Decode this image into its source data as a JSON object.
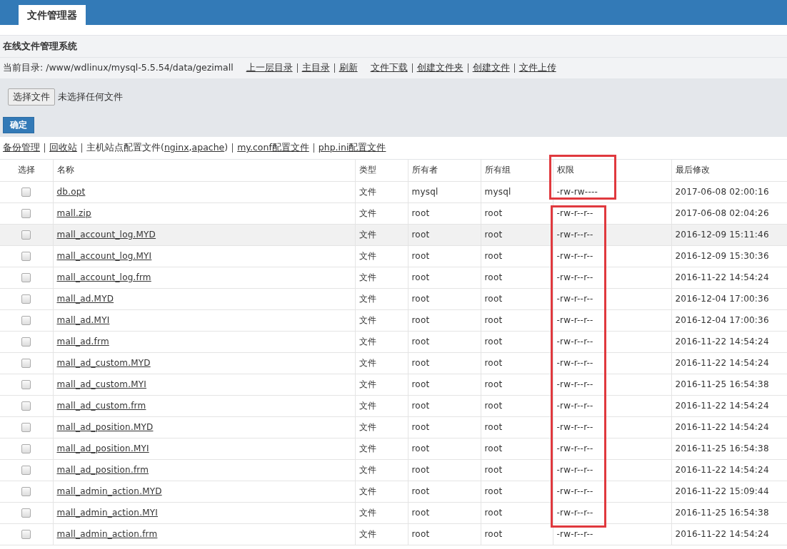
{
  "app_tab": {
    "label": "文件管理器",
    "selected": true
  },
  "panel_title": "在线文件管理系统",
  "current_dir": {
    "label": "当前目录: /www/wdlinux/mysql-5.5.54/data/gezimall",
    "link_groups": [
      [
        "上一层目录",
        "主目录",
        "刷新"
      ],
      [
        "文件下载",
        "创建文件夹",
        "创建文件",
        "文件上传"
      ]
    ]
  },
  "upload": {
    "choose_button": "选择文件",
    "no_file_text": "未选择任何文件",
    "submit_button": "确定"
  },
  "tool_links": [
    {
      "kind": "link",
      "text": "备份管理"
    },
    {
      "kind": "link",
      "text": "回收站"
    },
    {
      "kind": "mixed",
      "parts": [
        {
          "text": "主机站点配置文件(",
          "link": false
        },
        {
          "text": "nginx",
          "link": true
        },
        {
          "text": ",",
          "link": false
        },
        {
          "text": "apache",
          "link": true
        },
        {
          "text": ")",
          "link": false
        }
      ]
    },
    {
      "kind": "link",
      "text": "my.conf配置文件"
    },
    {
      "kind": "link",
      "text": "php.ini配置文件"
    }
  ],
  "table": {
    "columns": [
      "选择",
      "名称",
      "类型",
      "所有者",
      "所有组",
      "权限",
      "最后修改"
    ],
    "rows": [
      {
        "checked": false,
        "hovered": false,
        "name": "db.opt",
        "type": "文件",
        "owner": "mysql",
        "group": "mysql",
        "permissions": "-rw-rw----",
        "modified": "2017-06-08 02:00:16"
      },
      {
        "checked": false,
        "hovered": false,
        "name": "mall.zip",
        "type": "文件",
        "owner": "root",
        "group": "root",
        "permissions": "-rw-r--r--",
        "modified": "2017-06-08 02:04:26"
      },
      {
        "checked": false,
        "hovered": true,
        "name": "mall_account_log.MYD",
        "type": "文件",
        "owner": "root",
        "group": "root",
        "permissions": "-rw-r--r--",
        "modified": "2016-12-09 15:11:46"
      },
      {
        "checked": false,
        "hovered": false,
        "name": "mall_account_log.MYI",
        "type": "文件",
        "owner": "root",
        "group": "root",
        "permissions": "-rw-r--r--",
        "modified": "2016-12-09 15:30:36"
      },
      {
        "checked": false,
        "hovered": false,
        "name": "mall_account_log.frm",
        "type": "文件",
        "owner": "root",
        "group": "root",
        "permissions": "-rw-r--r--",
        "modified": "2016-11-22 14:54:24"
      },
      {
        "checked": false,
        "hovered": false,
        "name": "mall_ad.MYD",
        "type": "文件",
        "owner": "root",
        "group": "root",
        "permissions": "-rw-r--r--",
        "modified": "2016-12-04 17:00:36"
      },
      {
        "checked": false,
        "hovered": false,
        "name": "mall_ad.MYI",
        "type": "文件",
        "owner": "root",
        "group": "root",
        "permissions": "-rw-r--r--",
        "modified": "2016-12-04 17:00:36"
      },
      {
        "checked": false,
        "hovered": false,
        "name": "mall_ad.frm",
        "type": "文件",
        "owner": "root",
        "group": "root",
        "permissions": "-rw-r--r--",
        "modified": "2016-11-22 14:54:24"
      },
      {
        "checked": false,
        "hovered": false,
        "name": "mall_ad_custom.MYD",
        "type": "文件",
        "owner": "root",
        "group": "root",
        "permissions": "-rw-r--r--",
        "modified": "2016-11-22 14:54:24"
      },
      {
        "checked": false,
        "hovered": false,
        "name": "mall_ad_custom.MYI",
        "type": "文件",
        "owner": "root",
        "group": "root",
        "permissions": "-rw-r--r--",
        "modified": "2016-11-25 16:54:38"
      },
      {
        "checked": false,
        "hovered": false,
        "name": "mall_ad_custom.frm",
        "type": "文件",
        "owner": "root",
        "group": "root",
        "permissions": "-rw-r--r--",
        "modified": "2016-11-22 14:54:24"
      },
      {
        "checked": false,
        "hovered": false,
        "name": "mall_ad_position.MYD",
        "type": "文件",
        "owner": "root",
        "group": "root",
        "permissions": "-rw-r--r--",
        "modified": "2016-11-22 14:54:24"
      },
      {
        "checked": false,
        "hovered": false,
        "name": "mall_ad_position.MYI",
        "type": "文件",
        "owner": "root",
        "group": "root",
        "permissions": "-rw-r--r--",
        "modified": "2016-11-25 16:54:38"
      },
      {
        "checked": false,
        "hovered": false,
        "name": "mall_ad_position.frm",
        "type": "文件",
        "owner": "root",
        "group": "root",
        "permissions": "-rw-r--r--",
        "modified": "2016-11-22 14:54:24"
      },
      {
        "checked": false,
        "hovered": false,
        "name": "mall_admin_action.MYD",
        "type": "文件",
        "owner": "root",
        "group": "root",
        "permissions": "-rw-r--r--",
        "modified": "2016-11-22 15:09:44"
      },
      {
        "checked": false,
        "hovered": false,
        "name": "mall_admin_action.MYI",
        "type": "文件",
        "owner": "root",
        "group": "root",
        "permissions": "-rw-r--r--",
        "modified": "2016-11-25 16:54:38"
      },
      {
        "checked": false,
        "hovered": false,
        "name": "mall_admin_action.frm",
        "type": "文件",
        "owner": "root",
        "group": "root",
        "permissions": "-rw-r--r--",
        "modified": "2016-11-22 14:54:24"
      }
    ]
  },
  "annotations": [
    {
      "kind": "red-box"
    },
    {
      "kind": "red-box"
    }
  ]
}
